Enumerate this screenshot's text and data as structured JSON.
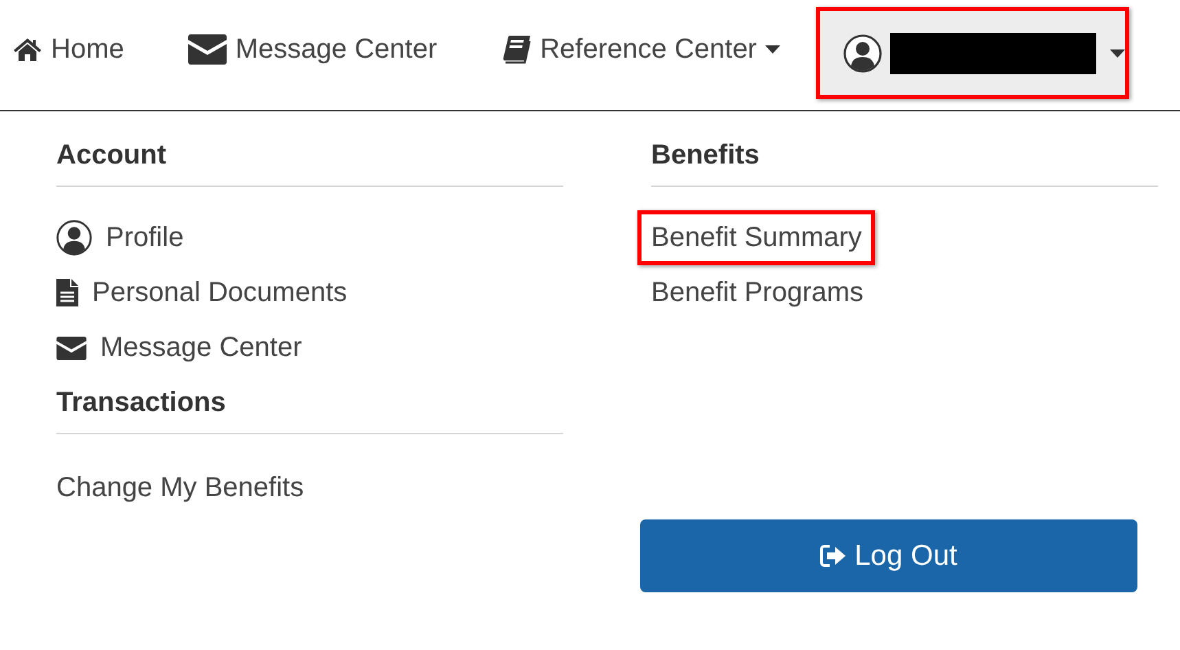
{
  "nav": {
    "items": [
      {
        "label": "Home",
        "kind": "link"
      },
      {
        "label": "Message Center",
        "kind": "link"
      },
      {
        "label": "Reference Center",
        "kind": "dropdown"
      }
    ],
    "user_menu": {
      "highlighted": true,
      "expanded": true
    }
  },
  "menu": {
    "columns": [
      {
        "sections": [
          {
            "heading": "Account",
            "items": [
              {
                "label": "Profile",
                "highlighted": false
              },
              {
                "label": "Personal Documents",
                "highlighted": false
              },
              {
                "label": "Message Center",
                "highlighted": false
              }
            ]
          },
          {
            "heading": "Transactions",
            "items": [
              {
                "label": "Change My Benefits",
                "highlighted": false
              }
            ]
          }
        ]
      },
      {
        "sections": [
          {
            "heading": "Benefits",
            "items": [
              {
                "label": "Benefit Summary",
                "highlighted": true
              },
              {
                "label": "Benefit Programs",
                "highlighted": false
              }
            ]
          }
        ]
      }
    ]
  },
  "logout": {
    "label": "Log Out"
  }
}
